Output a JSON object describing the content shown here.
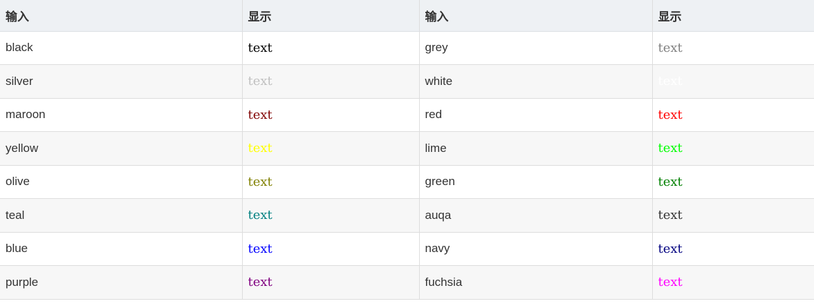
{
  "headers": [
    "输入",
    "显示",
    "输入",
    "显示"
  ],
  "rows": [
    {
      "left": {
        "name": "black",
        "sample": "text",
        "color": "#000000"
      },
      "right": {
        "name": "grey",
        "sample": "text",
        "color": "#808080"
      }
    },
    {
      "left": {
        "name": "silver",
        "sample": "text",
        "color": "#c0c0c0"
      },
      "right": {
        "name": "white",
        "sample": "text",
        "color": "#ffffff"
      }
    },
    {
      "left": {
        "name": "maroon",
        "sample": "text",
        "color": "#800000"
      },
      "right": {
        "name": "red",
        "sample": "text",
        "color": "#ff0000"
      }
    },
    {
      "left": {
        "name": "yellow",
        "sample": "text",
        "color": "#ffff00"
      },
      "right": {
        "name": "lime",
        "sample": "text",
        "color": "#00ff00"
      }
    },
    {
      "left": {
        "name": "olive",
        "sample": "text",
        "color": "#808000"
      },
      "right": {
        "name": "green",
        "sample": "text",
        "color": "#008000"
      }
    },
    {
      "left": {
        "name": "teal",
        "sample": "text",
        "color": "#008080"
      },
      "right": {
        "name": "auqa",
        "sample": "text",
        "color": "#333333"
      }
    },
    {
      "left": {
        "name": "blue",
        "sample": "text",
        "color": "#0000ff"
      },
      "right": {
        "name": "navy",
        "sample": "text",
        "color": "#000080"
      }
    },
    {
      "left": {
        "name": "purple",
        "sample": "text",
        "color": "#800080"
      },
      "right": {
        "name": "fuchsia",
        "sample": "text",
        "color": "#ff00ff"
      }
    }
  ]
}
